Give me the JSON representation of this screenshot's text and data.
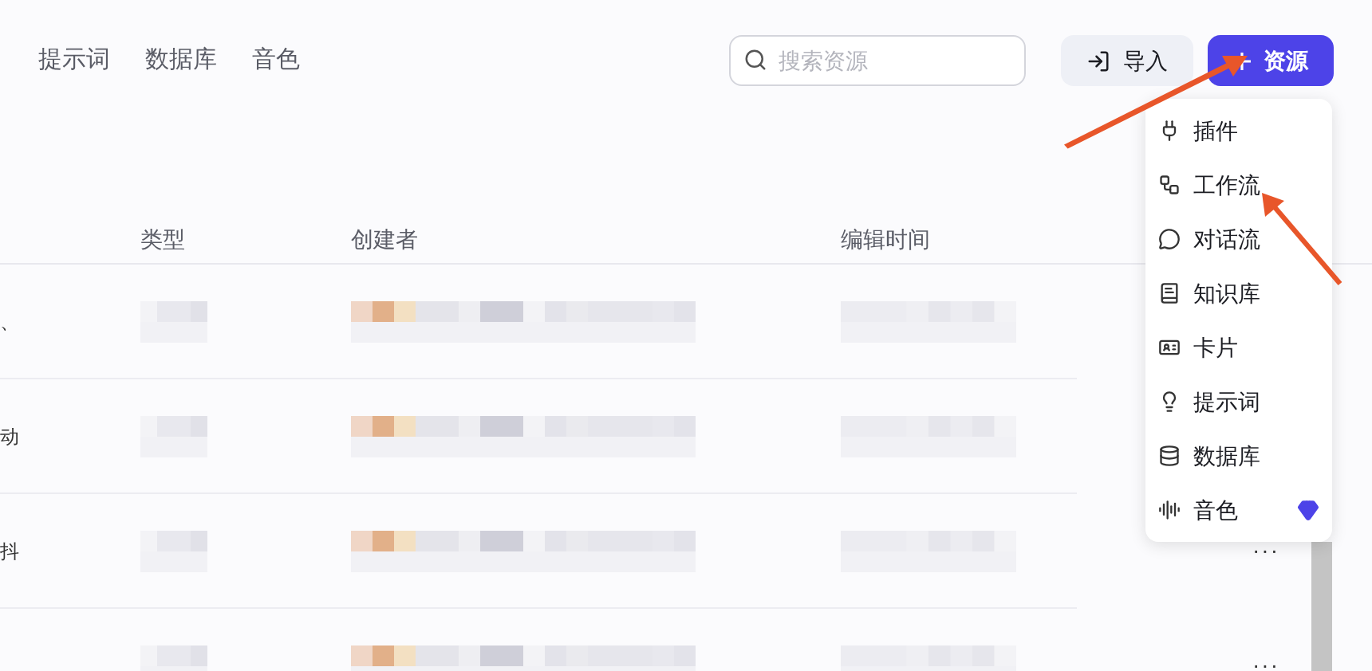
{
  "tabs": [
    {
      "label": "提示词",
      "selected": false
    },
    {
      "label": "数据库",
      "selected": false
    },
    {
      "label": "音色",
      "selected": false
    }
  ],
  "search": {
    "placeholder": "搜索资源"
  },
  "import_button": {
    "label": "导入"
  },
  "add_button": {
    "label": "资源"
  },
  "add_menu": {
    "items": [
      {
        "label": "插件",
        "premium": false
      },
      {
        "label": "工作流",
        "premium": false
      },
      {
        "label": "对话流",
        "premium": false
      },
      {
        "label": "知识库",
        "premium": false
      },
      {
        "label": "卡片",
        "premium": false
      },
      {
        "label": "提示词",
        "premium": false
      },
      {
        "label": "数据库",
        "premium": false
      },
      {
        "label": "音色",
        "premium": true
      }
    ]
  },
  "table": {
    "columns": [
      "类型",
      "创建者",
      "编辑时间"
    ],
    "rows": [
      {
        "name": "、"
      },
      {
        "name": "动"
      },
      {
        "name": "抖",
        "actions": "···"
      },
      {
        "actions": "···"
      }
    ]
  }
}
